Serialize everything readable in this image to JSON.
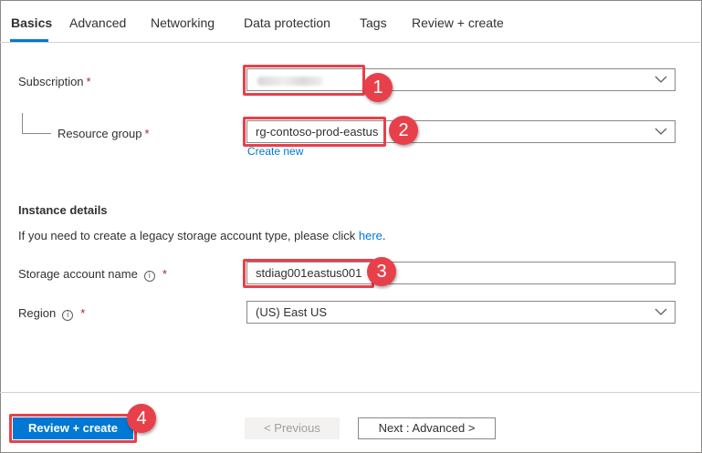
{
  "tabs": {
    "basics": "Basics",
    "advanced": "Advanced",
    "networking": "Networking",
    "data_protection": "Data protection",
    "tags": "Tags",
    "review_create": "Review + create"
  },
  "project_details": {
    "subscription_label": "Subscription",
    "subscription_value": "",
    "resource_group_label": "Resource group",
    "resource_group_value": "rg-contoso-prod-eastus",
    "create_new_link": "Create new",
    "required_marker": "*"
  },
  "instance_details": {
    "title": "Instance details",
    "legacy_text": "If you need to create a legacy storage account type, please click ",
    "legacy_link": "here",
    "legacy_suffix": ".",
    "storage_name_label": "Storage account name",
    "storage_name_value": "stdiag001eastus001",
    "region_label": "Region",
    "region_value": "(US) East US",
    "info_glyph": "i"
  },
  "footer": {
    "review_create_button": "Review + create",
    "previous_button": "< Previous",
    "next_button": "Next : Advanced >"
  },
  "callouts": [
    "1",
    "2",
    "3",
    "4"
  ],
  "colors": {
    "accent": "#0078d4",
    "callout": "#e8404a",
    "required": "#a4262c"
  }
}
